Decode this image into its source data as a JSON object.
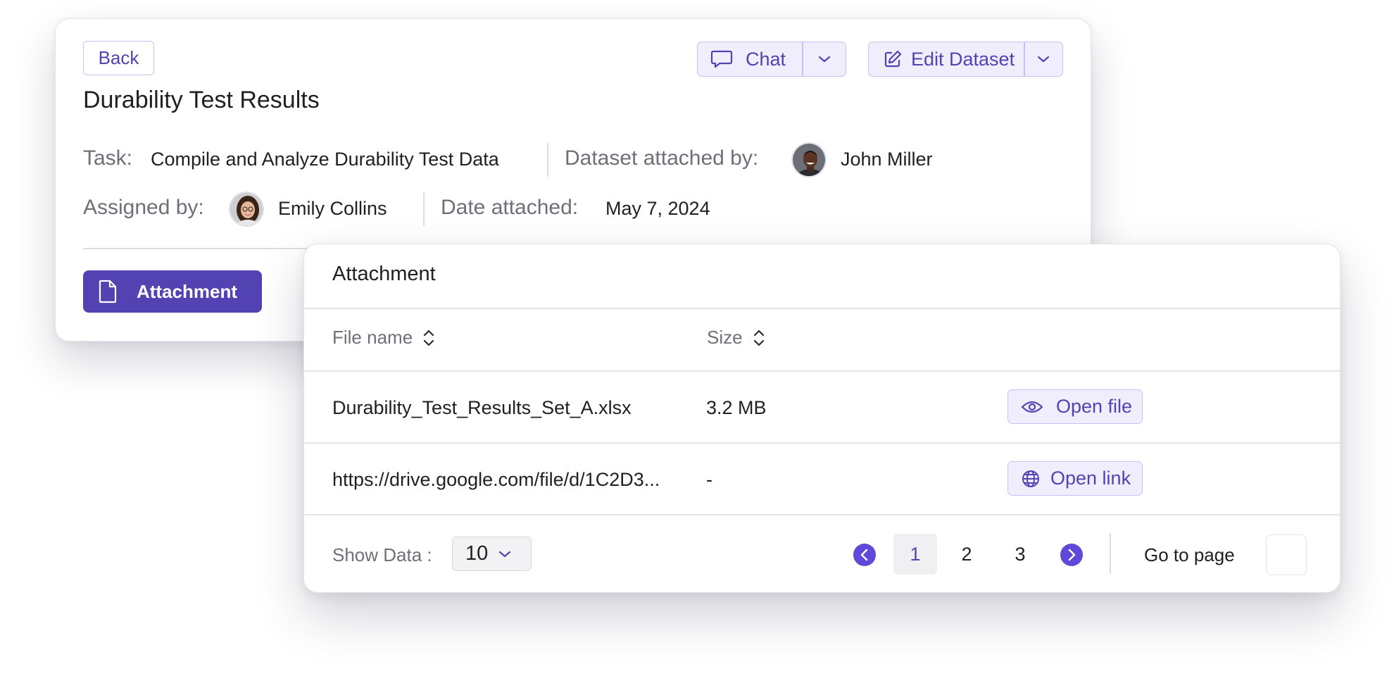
{
  "dataset": {
    "back_label": "Back",
    "title": "Durability Test Results",
    "chat_label": "Chat",
    "edit_label": "Edit Dataset",
    "task_label": "Task:",
    "task_value": "Compile and Analyze Durability Test Data",
    "attached_by_label": "Dataset attached by:",
    "attached_by_name": "John Miller",
    "assigned_by_label": "Assigned by:",
    "assigned_by_name": "Emily Collins",
    "date_label": "Date attached:",
    "date_value": "May 7, 2024",
    "attachment_tab_label": "Attachment"
  },
  "attachment_panel": {
    "title": "Attachment",
    "columns": [
      {
        "label": "File name"
      },
      {
        "label": "Size"
      }
    ],
    "rows": [
      {
        "name": "Durability_Test_Results_Set_A.xlsx",
        "size": "3.2 MB",
        "action": "Open file",
        "action_icon": "eye-icon"
      },
      {
        "name": "https://drive.google.com/file/d/1C2D3...",
        "size": "-",
        "action": "Open link",
        "action_icon": "globe-icon"
      }
    ]
  },
  "pagination": {
    "show_data_label": "Show Data :",
    "page_size": "10",
    "pages": [
      "1",
      "2",
      "3"
    ],
    "current_page": "1",
    "goto_label": "Go to page",
    "goto_value": ""
  },
  "colors": {
    "accent": "#5a45c8",
    "accent_soft": "#f0eefc",
    "accent_border": "#c8c0f2",
    "muted_text": "#6f6f7a"
  }
}
